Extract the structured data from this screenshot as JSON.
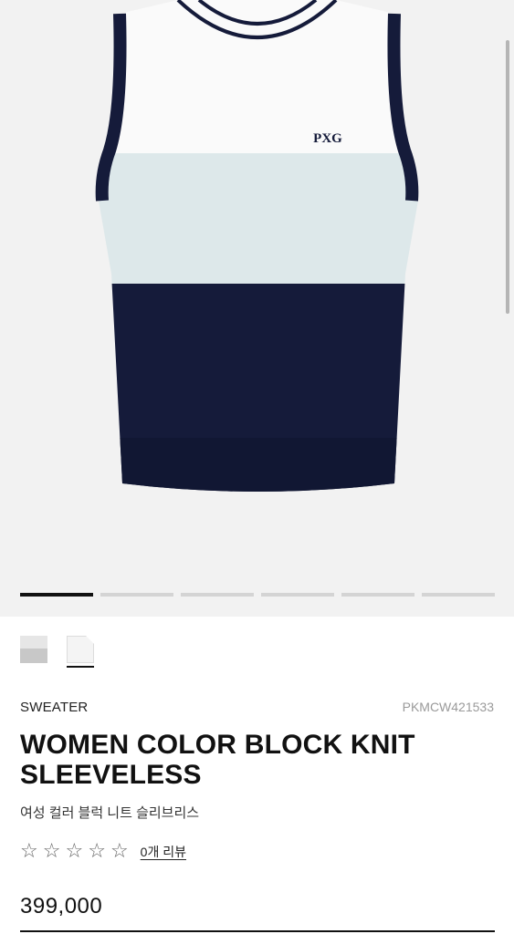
{
  "gallery": {
    "image_alt": "Women color block knit sleeveless vest",
    "logo_text": "PXG",
    "indicator_count": 6,
    "active_index": 0
  },
  "swatches": [
    {
      "name": "light-gray",
      "selected": false
    },
    {
      "name": "white",
      "selected": true
    }
  ],
  "product": {
    "category": "SWEATER",
    "sku": "PKMCW421533",
    "title_line1": "WOMEN COLOR BLOCK KNIT",
    "title_line2": "SLEEVELESS",
    "subtitle": "여성 컬러 블럭 니트 슬리브리스",
    "rating": 0,
    "reviews_label": "0개 리뷰",
    "price": "399,000"
  },
  "colors": {
    "navy": "#151b3a",
    "mint": "#dde8ea",
    "white": "#fafafa",
    "indicator_active": "#111111",
    "indicator_inactive": "#d4d4d4"
  }
}
